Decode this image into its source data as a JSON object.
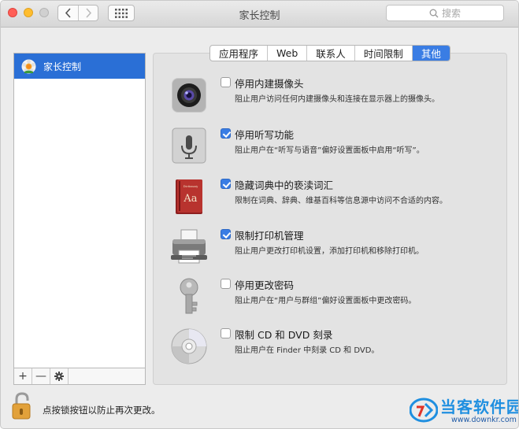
{
  "window": {
    "title": "家长控制"
  },
  "search": {
    "placeholder": "搜索"
  },
  "sidebar": {
    "items": [
      {
        "label": "家长控制",
        "selected": true
      }
    ],
    "toolbar": {
      "add": "+",
      "remove": "—"
    }
  },
  "tabs": [
    {
      "label": "应用程序",
      "active": false
    },
    {
      "label": "Web",
      "active": false
    },
    {
      "label": "联系人",
      "active": false
    },
    {
      "label": "时间限制",
      "active": false
    },
    {
      "label": "其他",
      "active": true
    }
  ],
  "options": [
    {
      "icon": "camera-icon",
      "checked": false,
      "title": "停用内建摄像头",
      "desc": "阻止用户访问任何内建摄像头和连接在显示器上的摄像头。"
    },
    {
      "icon": "microphone-icon",
      "checked": true,
      "title": "停用听写功能",
      "desc": "阻止用户在“听写与语音”偏好设置面板中启用“听写”。"
    },
    {
      "icon": "dictionary-icon",
      "checked": true,
      "title": "隐藏词典中的亵渎词汇",
      "desc": "限制在词典、辞典、维基百科等信息源中访问不合适的内容。"
    },
    {
      "icon": "printer-icon",
      "checked": true,
      "title": "限制打印机管理",
      "desc": "阻止用户更改打印机设置，添加打印机和移除打印机。"
    },
    {
      "icon": "key-icon",
      "checked": false,
      "title": "停用更改密码",
      "desc": "阻止用户在“用户与群组”偏好设置面板中更改密码。"
    },
    {
      "icon": "cd-icon",
      "checked": false,
      "title": "限制 CD 和 DVD 刻录",
      "desc": "阻止用户在 Finder 中刻录 CD 和 DVD。"
    }
  ],
  "footer": {
    "lock_text": "点按锁按钮以防止再次更改。"
  },
  "watermark": {
    "title": "当客软件园",
    "url": "www.downkr.com"
  },
  "colors": {
    "accent": "#3a7de4",
    "selection": "#2a6fd6",
    "window_bg": "#ececec"
  }
}
